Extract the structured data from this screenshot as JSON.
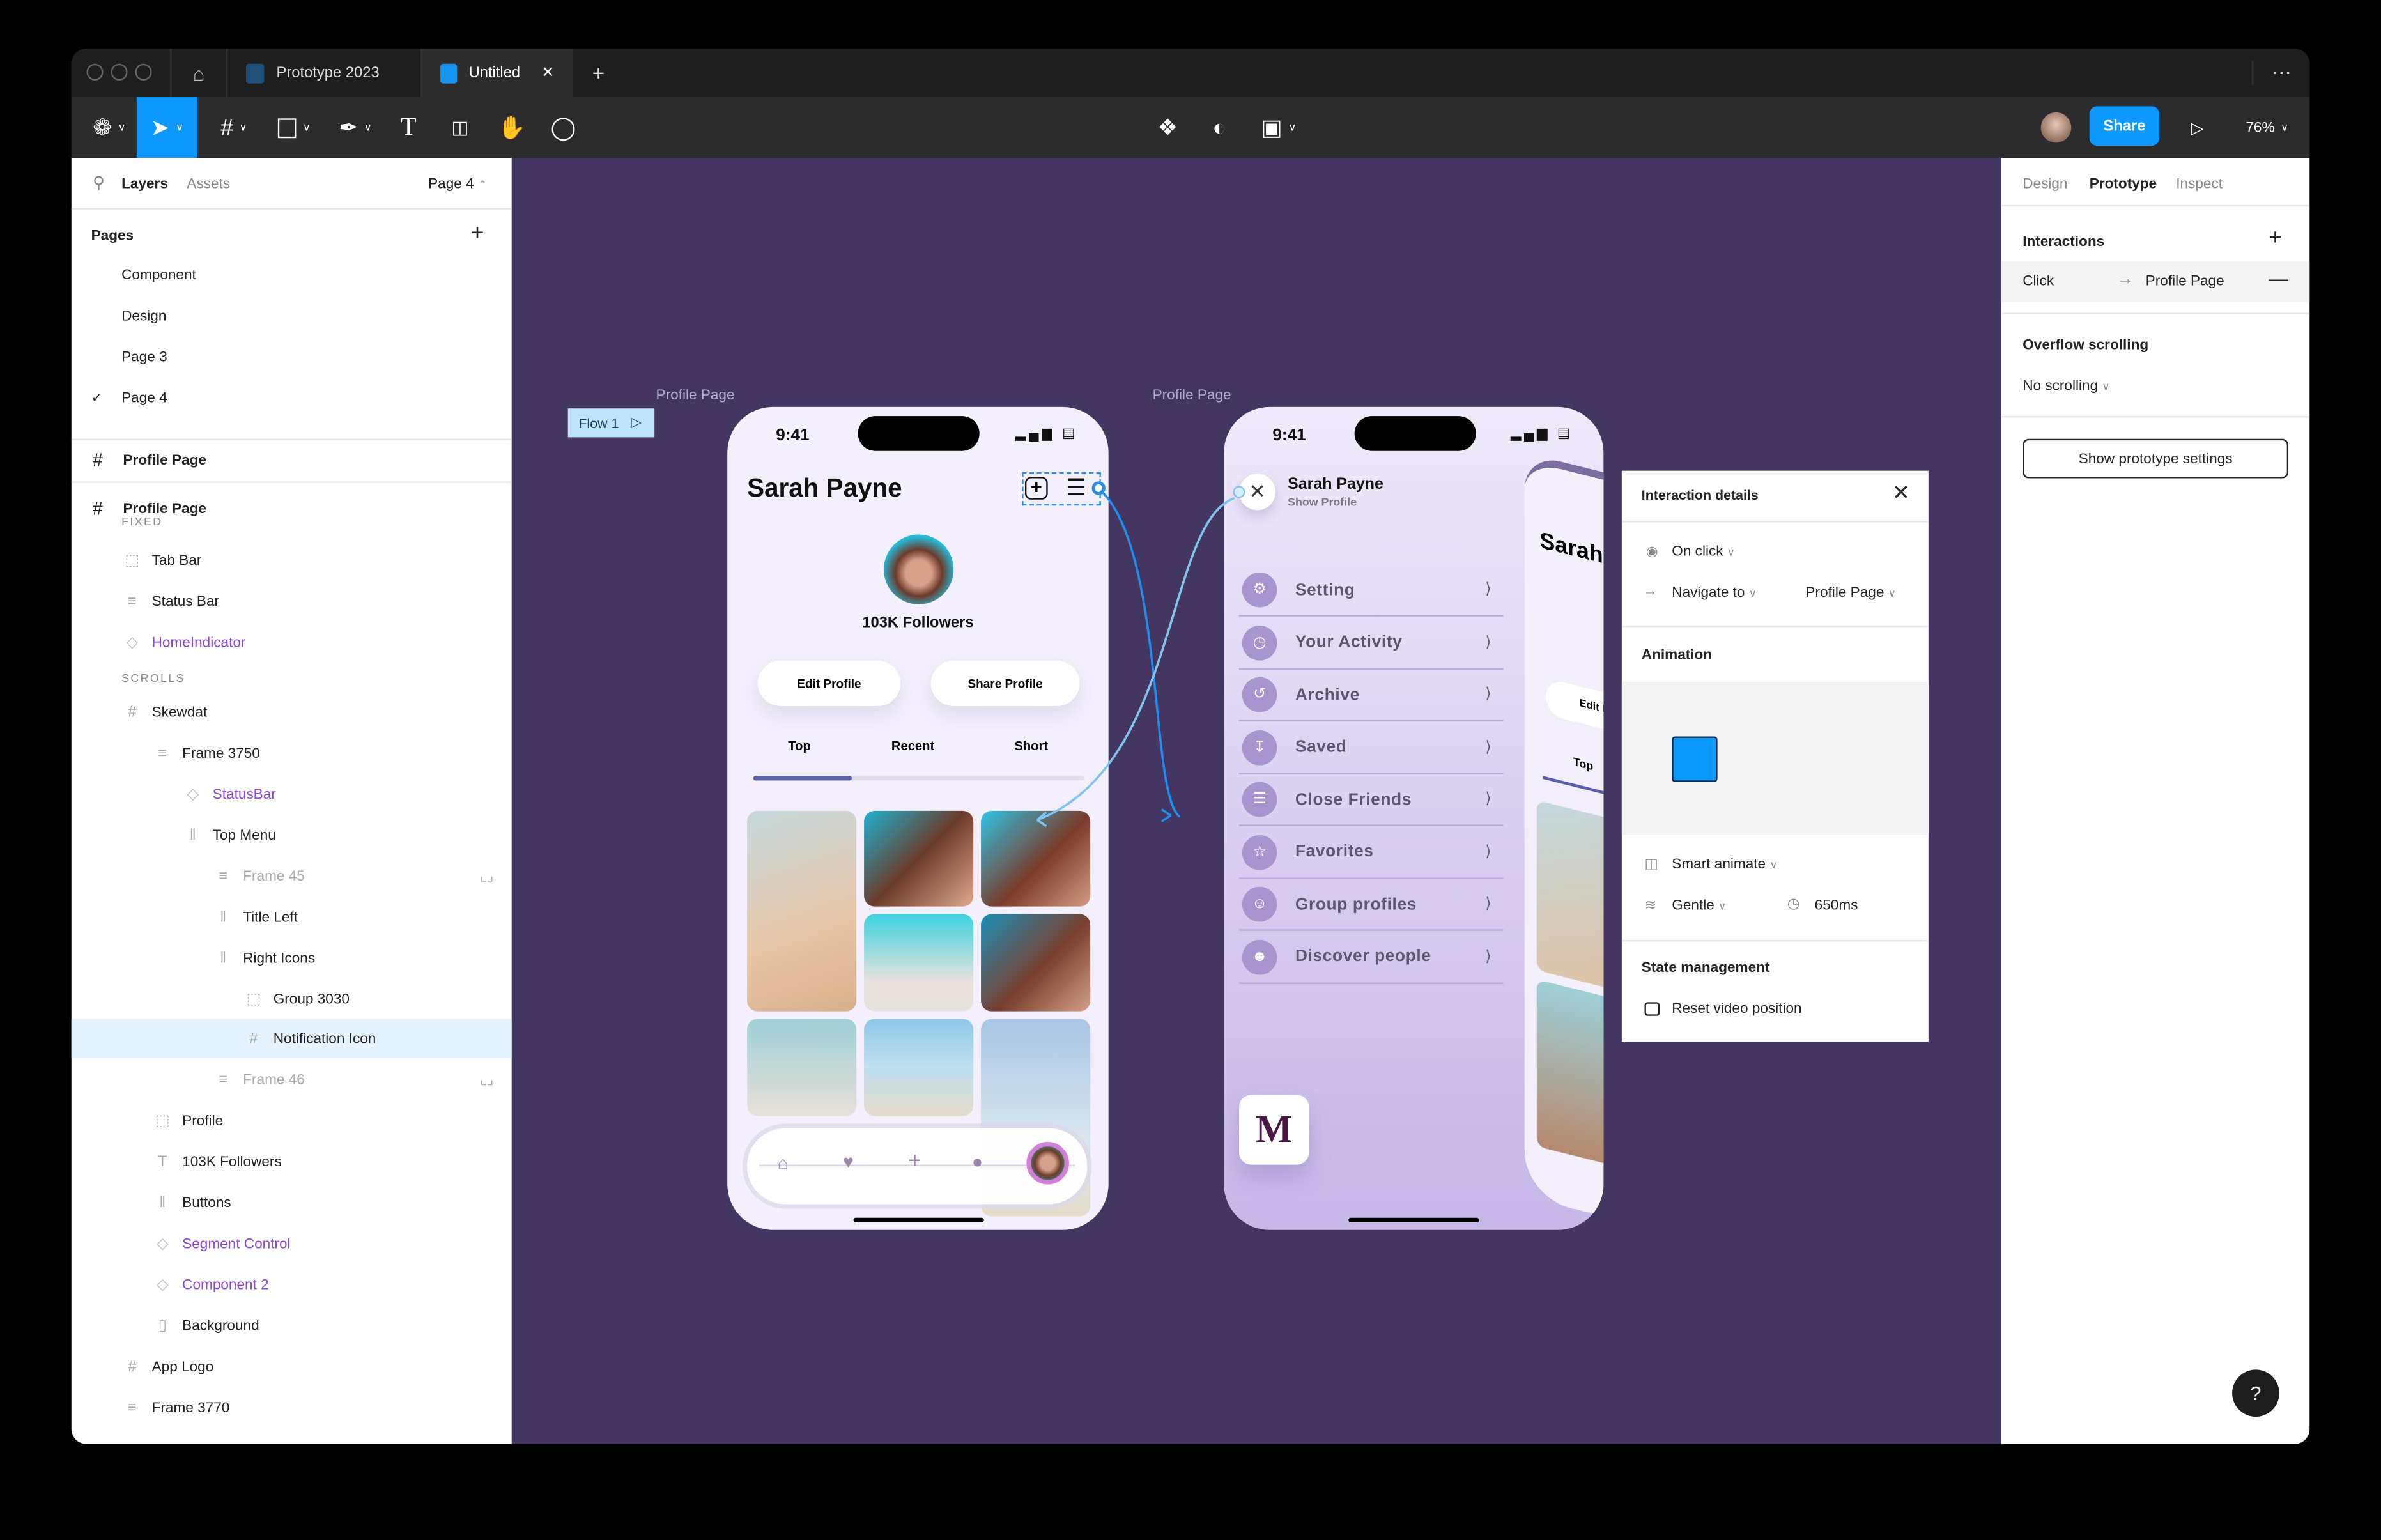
{
  "window": {
    "tabs": [
      {
        "label": "Prototype 2023",
        "active": false
      },
      {
        "label": "Untitled",
        "active": true
      }
    ],
    "new_tab": "+",
    "more": "⋯",
    "home_icon": "home-icon"
  },
  "toolbar": {
    "share": "Share",
    "zoom": "76%",
    "accent": "#0d99ff",
    "active_tool": "move"
  },
  "left_panel": {
    "tabs": {
      "layers": "Layers",
      "assets": "Assets"
    },
    "page_selector": "Page 4",
    "pages_title": "Pages",
    "pages": [
      {
        "label": "Component"
      },
      {
        "label": "Design"
      },
      {
        "label": "Page 3"
      },
      {
        "label": "Page 4",
        "current": true
      }
    ],
    "frames": [
      "Profile Page",
      "Profile Page"
    ],
    "layers": [
      {
        "label": "FIXED",
        "type": "section",
        "depth": 1
      },
      {
        "label": "Tab Bar",
        "type": "group",
        "depth": 1
      },
      {
        "label": "Status Bar",
        "type": "stack",
        "depth": 1
      },
      {
        "label": "HomeIndicator",
        "type": "component",
        "depth": 1
      },
      {
        "label": "SCROLLS",
        "type": "section",
        "depth": 1
      },
      {
        "label": "Skewdat",
        "type": "frame",
        "depth": 1
      },
      {
        "label": "Frame 3750",
        "type": "stack",
        "depth": 2
      },
      {
        "label": "StatusBar",
        "type": "component",
        "depth": 3
      },
      {
        "label": "Top Menu",
        "type": "hstack",
        "depth": 3
      },
      {
        "label": "Frame 45",
        "type": "stack",
        "depth": 4,
        "hidden": true
      },
      {
        "label": "Title Left",
        "type": "hstack",
        "depth": 4
      },
      {
        "label": "Right Icons",
        "type": "hstack",
        "depth": 4
      },
      {
        "label": "Group 3030",
        "type": "group",
        "depth": 5
      },
      {
        "label": "Notification Icon",
        "type": "frame",
        "depth": 5,
        "selected": true
      },
      {
        "label": "Frame 46",
        "type": "stack",
        "depth": 4,
        "hidden": true
      },
      {
        "label": "Profile",
        "type": "group",
        "depth": 2
      },
      {
        "label": "103K Followers",
        "type": "text",
        "depth": 2
      },
      {
        "label": "Buttons",
        "type": "hstack",
        "depth": 2
      },
      {
        "label": "Segment Control",
        "type": "component",
        "depth": 2
      },
      {
        "label": "Component 2",
        "type": "component",
        "depth": 2
      },
      {
        "label": "Background",
        "type": "rect",
        "depth": 2
      },
      {
        "label": "App Logo",
        "type": "frame",
        "depth": 1
      },
      {
        "label": "Frame 3770",
        "type": "stack",
        "depth": 1
      }
    ]
  },
  "canvas": {
    "bg": "#433761",
    "flow_label": "Flow 1",
    "frame1": {
      "label": "Profile Page",
      "time": "9:41",
      "name": "Sarah Payne",
      "followers": "103K Followers",
      "buttons": [
        "Edit Profile",
        "Share Profile"
      ],
      "segments": [
        "Top",
        "Recent",
        "Short"
      ],
      "nav_icons": [
        "home-icon",
        "heart-icon",
        "plus-icon",
        "chat-icon",
        "avatar"
      ]
    },
    "frame2": {
      "label": "Profile Page",
      "time": "9:41",
      "name": "Sarah Payne",
      "subtitle": "Show Profile",
      "menu": [
        {
          "label": "Setting",
          "icon": "gear-icon"
        },
        {
          "label": "Your Activity",
          "icon": "clock-icon"
        },
        {
          "label": "Archive",
          "icon": "history-icon"
        },
        {
          "label": "Saved",
          "icon": "download-icon"
        },
        {
          "label": "Close Friends",
          "icon": "list-icon"
        },
        {
          "label": "Favorites",
          "icon": "star-icon"
        },
        {
          "label": "Group profiles",
          "icon": "group-icon"
        },
        {
          "label": "Discover people",
          "icon": "add-person-icon"
        }
      ],
      "logo": "M",
      "peek_name": "Sarah",
      "peek_button": "Edit P",
      "peek_tab": "Top"
    }
  },
  "interaction_details": {
    "title": "Interaction details",
    "trigger": "On click",
    "action": "Navigate to",
    "destination": "Profile Page",
    "animation_title": "Animation",
    "animation_type": "Smart animate",
    "easing": "Gentle",
    "duration": "650ms",
    "state_title": "State management",
    "reset_video": "Reset video position",
    "reset_video_checked": false
  },
  "right_panel": {
    "tabs": [
      "Design",
      "Prototype",
      "Inspect"
    ],
    "active_tab": "Prototype",
    "interactions_title": "Interactions",
    "interaction": {
      "trigger": "Click",
      "destination": "Profile Page"
    },
    "overflow_title": "Overflow scrolling",
    "overflow_value": "No scrolling",
    "settings_button": "Show prototype settings"
  },
  "help": "?"
}
